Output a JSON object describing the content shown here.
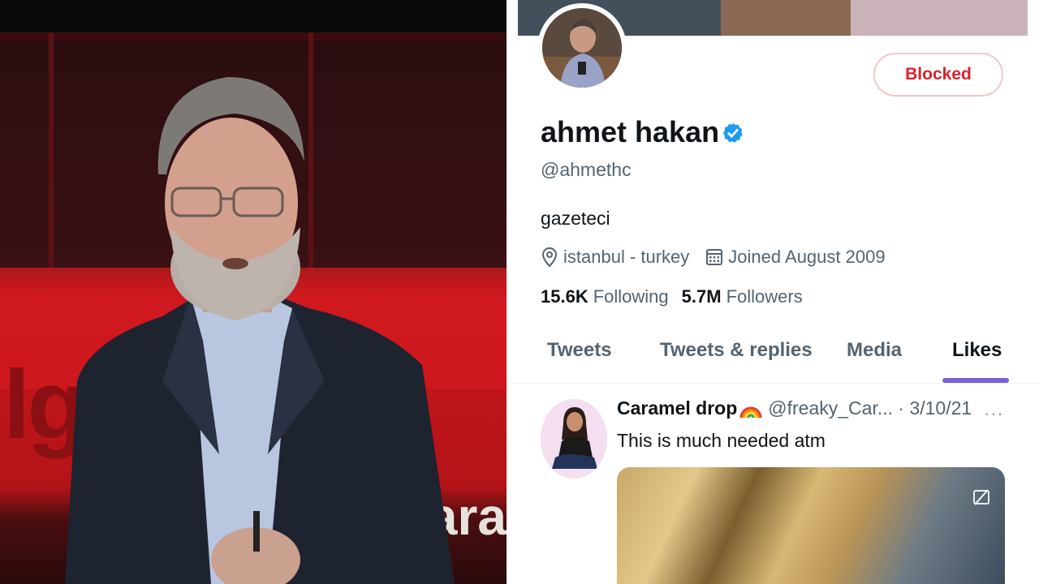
{
  "photo": {
    "background_words": [
      "lg",
      "tara"
    ]
  },
  "profile": {
    "display_name": "ahmet hakan",
    "handle": "@ahmethc",
    "bio": "gazeteci",
    "location": "istanbul - turkey",
    "joined": "Joined August 2009",
    "following_count": "15.6K",
    "following_label": "Following",
    "followers_count": "5.7M",
    "followers_label": "Followers",
    "blocked_label": "Blocked",
    "verified": true
  },
  "tabs": [
    {
      "label": "Tweets",
      "active": false
    },
    {
      "label": "Tweets & replies",
      "active": false
    },
    {
      "label": "Media",
      "active": false
    },
    {
      "label": "Likes",
      "active": true
    }
  ],
  "tweet": {
    "author_name": "Caramel drop",
    "author_handle": "@freaky_Car... · 3/10/21",
    "text": "This is much needed atm",
    "more_label": "···"
  },
  "colors": {
    "accent_tab": "#7c5fd6",
    "blocked_red": "#d8232a",
    "verified_blue": "#1d9bf0"
  },
  "icons": [
    "location-pin-icon",
    "calendar-icon",
    "verified-badge-icon",
    "more-icon",
    "rainbow-emoji-icon",
    "media-captions-icon"
  ]
}
